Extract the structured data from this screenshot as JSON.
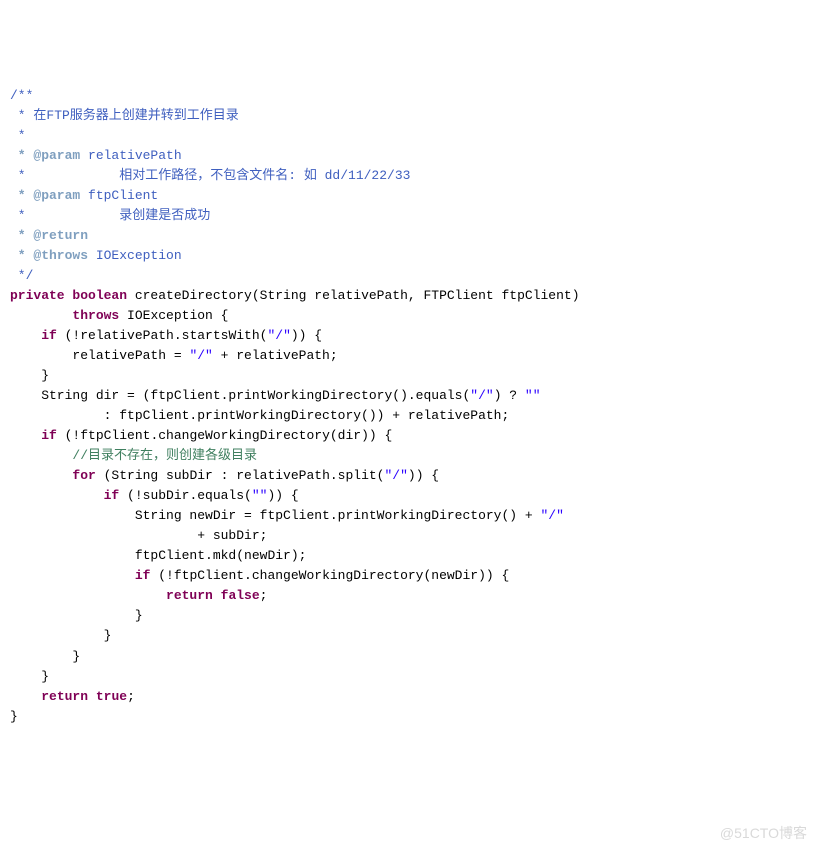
{
  "doc": {
    "open": "/**",
    "l1": " * 在FTP服务器上创建并转到工作目录",
    "l2": " *",
    "tag_param": " * @param",
    "p1_name": " relativePath",
    "p1_desc": " *            相对工作路径，不包含文件名: 如 dd/11/22/33",
    "p2_name": " ftpClient",
    "p2_desc": " *            录创建是否成功",
    "tag_ret": " * @return",
    "tag_thr": " * @throws",
    "thr_name": " IOException",
    "close": " */"
  },
  "kw": {
    "private": "private",
    "boolean": "boolean",
    "throws": "throws",
    "if": "if",
    "for": "for",
    "return": "return",
    "true": "true",
    "false": "false"
  },
  "code": {
    "sig1": " createDirectory(String relativePath, FTPClient ftpClient)",
    "sig2": " IOException {",
    "c1a": " (!relativePath.startsWith(",
    "c1b": ")) {",
    "c2a": "        relativePath = ",
    "c2b": " + relativePath;",
    "c3": "    }",
    "c4a": "    String dir = (ftpClient.printWorkingDirectory().equals(",
    "c4b": ") ? ",
    "c5": "            : ftpClient.printWorkingDirectory()) + relativePath;",
    "c6a": " (!ftpClient.changeWorkingDirectory(dir)) {",
    "cmt": "        //目录不存在，则创建各级目录",
    "c7a": " (String subDir : relativePath.split(",
    "c7b": ")) {",
    "c8a": " (!subDir.equals(",
    "c8b": ")) {",
    "c9a": "                String newDir = ftpClient.printWorkingDirectory() + ",
    "c10": "                        + subDir;",
    "c11": "                ftpClient.mkd(newDir);",
    "c12a": " (!ftpClient.changeWorkingDirectory(newDir)) {",
    "c13a": "                    ",
    "c13b": " ",
    "c13c": ";",
    "c14": "                }",
    "c15": "            }",
    "c16": "        }",
    "c17": "    }",
    "c18a": "    ",
    "c18b": " ",
    "c18c": ";",
    "c19": "}"
  },
  "str": {
    "slash": "\"/\"",
    "empty": "\"\""
  },
  "watermark": "@51CTO博客"
}
